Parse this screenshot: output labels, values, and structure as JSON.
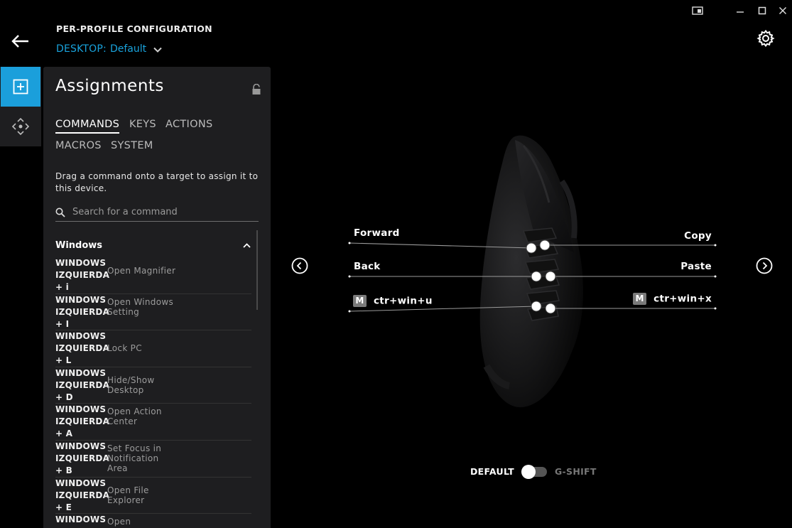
{
  "window": {
    "controls": [
      "snap-icon",
      "minimize-icon",
      "maximize-icon",
      "close-icon"
    ]
  },
  "header": {
    "title": "PER-PROFILE CONFIGURATION",
    "profile_key": "DESKTOP:",
    "profile_value": "Default"
  },
  "panel": {
    "title": "Assignments",
    "tabs": [
      "COMMANDS",
      "KEYS",
      "ACTIONS",
      "MACROS",
      "SYSTEM"
    ],
    "hint": "Drag a command onto a target to assign it to this device.",
    "search_placeholder": "Search for a command",
    "group": "Windows",
    "commands": [
      {
        "key": "WINDOWS\nIZQUIERDA\n+ i",
        "desc": "Open Magnifier"
      },
      {
        "key": "WINDOWS\nIZQUIERDA\n+ I",
        "desc": "Open Windows Setting"
      },
      {
        "key": "WINDOWS\nIZQUIERDA\n+ L",
        "desc": "Lock PC"
      },
      {
        "key": "WINDOWS\nIZQUIERDA\n+ D",
        "desc": "Hide/Show Desktop"
      },
      {
        "key": "WINDOWS\nIZQUIERDA\n+ A",
        "desc": "Open Action Center"
      },
      {
        "key": "WINDOWS\nIZQUIERDA\n+ B",
        "desc": "Set Focus in Notification Area"
      },
      {
        "key": "WINDOWS\nIZQUIERDA\n+ E",
        "desc": "Open File Explorer"
      },
      {
        "key": "WINDOWS\nIZQUIERDA",
        "desc": "Open"
      }
    ]
  },
  "assignments": {
    "left": [
      "Forward",
      "Back",
      "ctr+win+u"
    ],
    "right": [
      "Copy",
      "Paste",
      "ctr+win+x"
    ],
    "macro_badge": "M"
  },
  "mode_toggle": {
    "left_label": "DEFAULT",
    "right_label": "G-SHIFT",
    "state": "default"
  },
  "colors": {
    "accent": "#1b9fdb",
    "panel_bg": "#1e1e20",
    "background": "#000000"
  }
}
